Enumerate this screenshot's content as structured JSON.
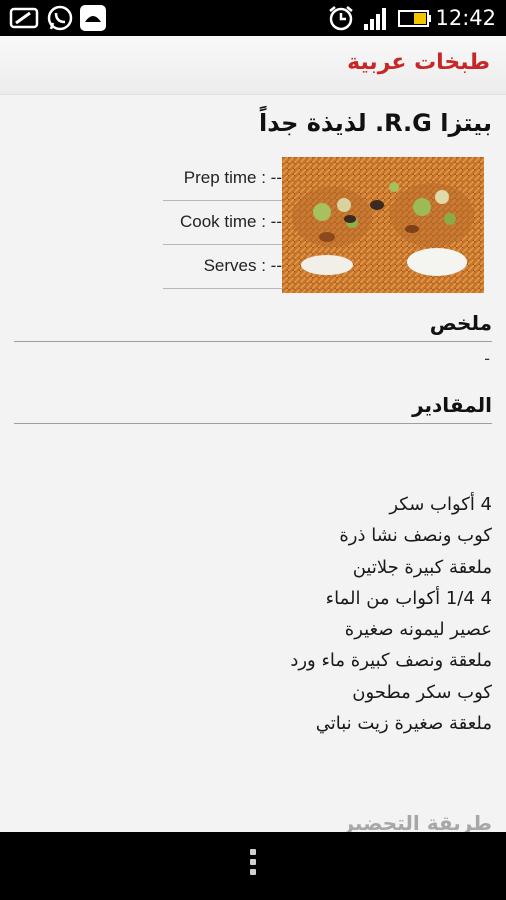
{
  "status_bar": {
    "time": "12:42",
    "icons": [
      "screenshot-icon",
      "whatsapp-icon",
      "chat-app-icon",
      "alarm-icon",
      "signal-icon",
      "battery-icon"
    ]
  },
  "action_bar": {
    "title": "طبخات عربية",
    "title_color": "#c62828"
  },
  "recipe": {
    "title": "بيتزا R.G. لذيذة جداً",
    "image": "kunafa-dessert-photo",
    "prep_time": "Prep time : --",
    "cook_time": "Cook time : --",
    "serves": "Serves : --"
  },
  "summary": {
    "heading": "ملخص",
    "text": "-"
  },
  "ingredients": {
    "heading": "المقادير",
    "items": [
      "4 أكواب سكر",
      "كوب ونصف نشا ذرة",
      "ملعقة كبيرة جلاتين",
      "4 1/4 أكواب من الماء",
      "عصير ليمونه صغيرة",
      "ملعقة ونصف كبيرة ماء ورد",
      "كوب سكر مطحون",
      "ملعقة صغيرة زيت نباتي"
    ]
  },
  "preparation": {
    "heading": "طريقة التحضير"
  },
  "nav_bar": {
    "menu_icon": "overflow-menu-icon"
  }
}
